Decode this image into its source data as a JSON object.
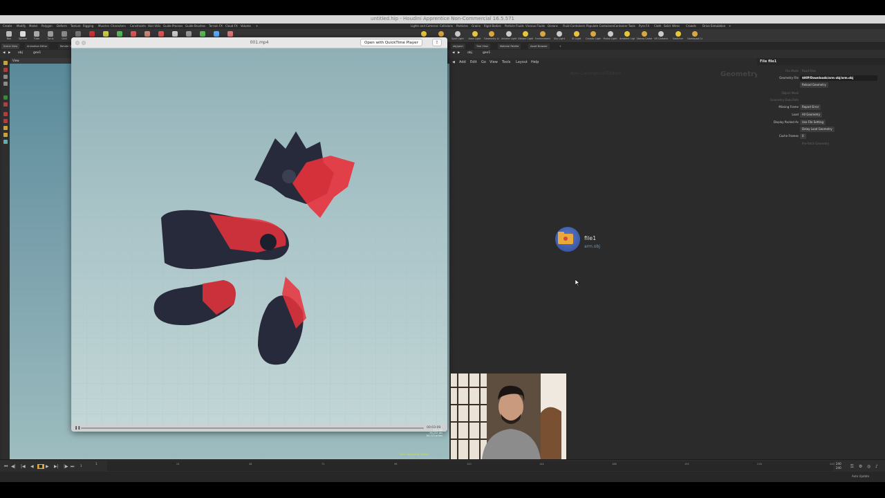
{
  "window": {
    "title": "untitled.hip - Houdini Apprentice Non-Commercial 16.5.571"
  },
  "shelf_tabs": [
    "Create",
    "Modify",
    "Model",
    "Polygon",
    "Deform",
    "Texture",
    "Rigging",
    "Muscles",
    "Characters",
    "Constraints",
    "Hair Utils",
    "Guide Process",
    "Guide Brushes",
    "Terrain FX",
    "Cloud FX",
    "Volume",
    "+",
    "Lights and Cameras",
    "Collisions",
    "Particles",
    "Grains",
    "Rigid Bodies",
    "Particle Fluids",
    "Viscous Fluids",
    "Oceans",
    "Fluid Containers",
    "Populate Containers",
    "Container Tools",
    "Pyro FX",
    "Cloth",
    "Solid",
    "Wires",
    "Crowds",
    "Drive Simulation",
    "+"
  ],
  "shelf_left_tools": [
    "Box",
    "Sphere",
    "Tube",
    "Torus",
    "Grid",
    "Null",
    "Line",
    "Circle",
    "Curve",
    "Draw Curve",
    "Path",
    "Spray Paint",
    "Font",
    "Platonic Solids",
    "L-System",
    "Metaball",
    "File"
  ],
  "shelf_right_tools": [
    "Camera",
    "Point Light",
    "Spot Light",
    "Area Light",
    "Geometry Light",
    "Volume Light",
    "Distant Light",
    "Environment Light",
    "Sky Light",
    "GI Light",
    "Caustic Light",
    "Portal Light",
    "Ambient Light",
    "Stereo Camera",
    "VR Camera",
    "Switcher",
    "Gamepad Camera"
  ],
  "left_pane": {
    "tabs": [
      "Scene View",
      "Animation Editor",
      "Render View"
    ],
    "path": [
      "obj",
      "geo1"
    ],
    "view_label": "View"
  },
  "quicktime": {
    "title": "001.mp4",
    "open_button": "Open with QuickTime Player",
    "time": "00:03:09"
  },
  "viewport_overlay": {
    "stats": [
      "4.01 fps",
      "56,232 pts",
      "84,123 prims"
    ],
    "noncommercial": "Non-Commercial Edition"
  },
  "right_pane": {
    "tabs": [
      "obj/geo1",
      "Tree View",
      "Material Palette",
      "Asset Browser",
      "+"
    ],
    "path": [
      "obj",
      "geo1"
    ],
    "menu": [
      "Add",
      "Edit",
      "Go",
      "View",
      "Tools",
      "Layout",
      "Help"
    ],
    "watermark": "Non-Commercial Edition",
    "context_label": "Geometry"
  },
  "node": {
    "name": "file1",
    "file": "arm.obj"
  },
  "params": {
    "header": "File  file1",
    "rows": [
      {
        "label": "File Mode",
        "value": "Read Files",
        "dim": true
      },
      {
        "label": "Geometry File",
        "value": "$HIP/Downloads/arm obj/arm.obj",
        "wide": true
      },
      {
        "label": "",
        "value": "Reload Geometry"
      },
      {
        "label": "Object Mask",
        "value": "",
        "dim": true
      },
      {
        "label": "Geometry Data Path",
        "value": "",
        "dim": true
      },
      {
        "label": "Missing Frame",
        "value": "Report Error"
      },
      {
        "label": "Load",
        "value": "All Geometry"
      },
      {
        "label": "Display Packed As",
        "value": "Use File Setting"
      },
      {
        "label": "",
        "value": "Delay Load Geometry"
      },
      {
        "label": "Cache Frames",
        "value": "0"
      },
      {
        "label": "",
        "value": "Pre-fetch Geometry",
        "dim": true
      }
    ]
  },
  "timeline": {
    "start": "1",
    "current": "1",
    "ticks": [
      "24",
      "48",
      "72",
      "96",
      "120",
      "144",
      "168",
      "192",
      "216",
      "240"
    ],
    "end1": "240",
    "end2": "240"
  },
  "status": {
    "auto_update": "Auto Update"
  },
  "colors": {
    "viewport_top": "#5a8a9a",
    "mesh_dark": "#262a3a",
    "mesh_red": "#e8323c",
    "node_blue": "#3d5aa8",
    "folder": "#e8a93a"
  }
}
